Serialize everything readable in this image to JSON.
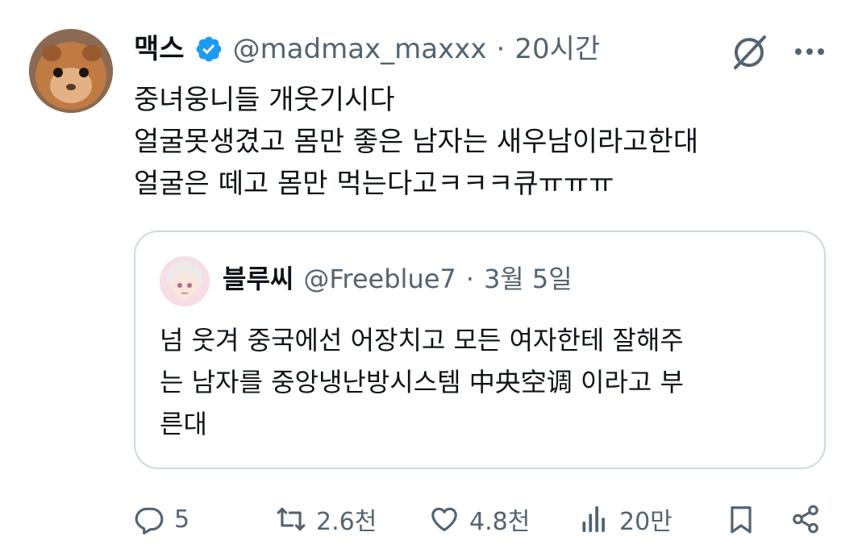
{
  "tweet": {
    "author": {
      "display_name": "맥스",
      "handle": "@madmax_maxxx",
      "avatar_icon": "guinea-pig-avatar",
      "verified_icon": "verified-badge-icon"
    },
    "separator": "·",
    "time": "20시간",
    "text_lines": [
      "중녀웅니들 개웃기시다",
      "얼굴못생겼고 몸만 좋은 남자는 새우남이라고한대",
      "얼굴은 떼고 몸만 먹는다고ㅋㅋㅋ큐ㅠㅠㅠ"
    ],
    "quoted": {
      "display_name": "블루씨",
      "handle": "@Freeblue7",
      "separator": "·",
      "date": "3월 5일",
      "avatar_icon": "anime-character-avatar",
      "text_lines": [
        "넘 웃겨 중국에선 어장치고 모든 여자한테 잘해주",
        "는 남자를 중앙냉난방시스템 中央空调 이라고 부",
        "른대"
      ]
    },
    "actions": {
      "reply": "5",
      "retweet": "2.6천",
      "like": "4.8천",
      "views": "20만"
    }
  },
  "colors": {
    "text": "#0f1419",
    "secondary": "#536471",
    "verified": "#1d9bf0",
    "border": "#cfd9de"
  }
}
